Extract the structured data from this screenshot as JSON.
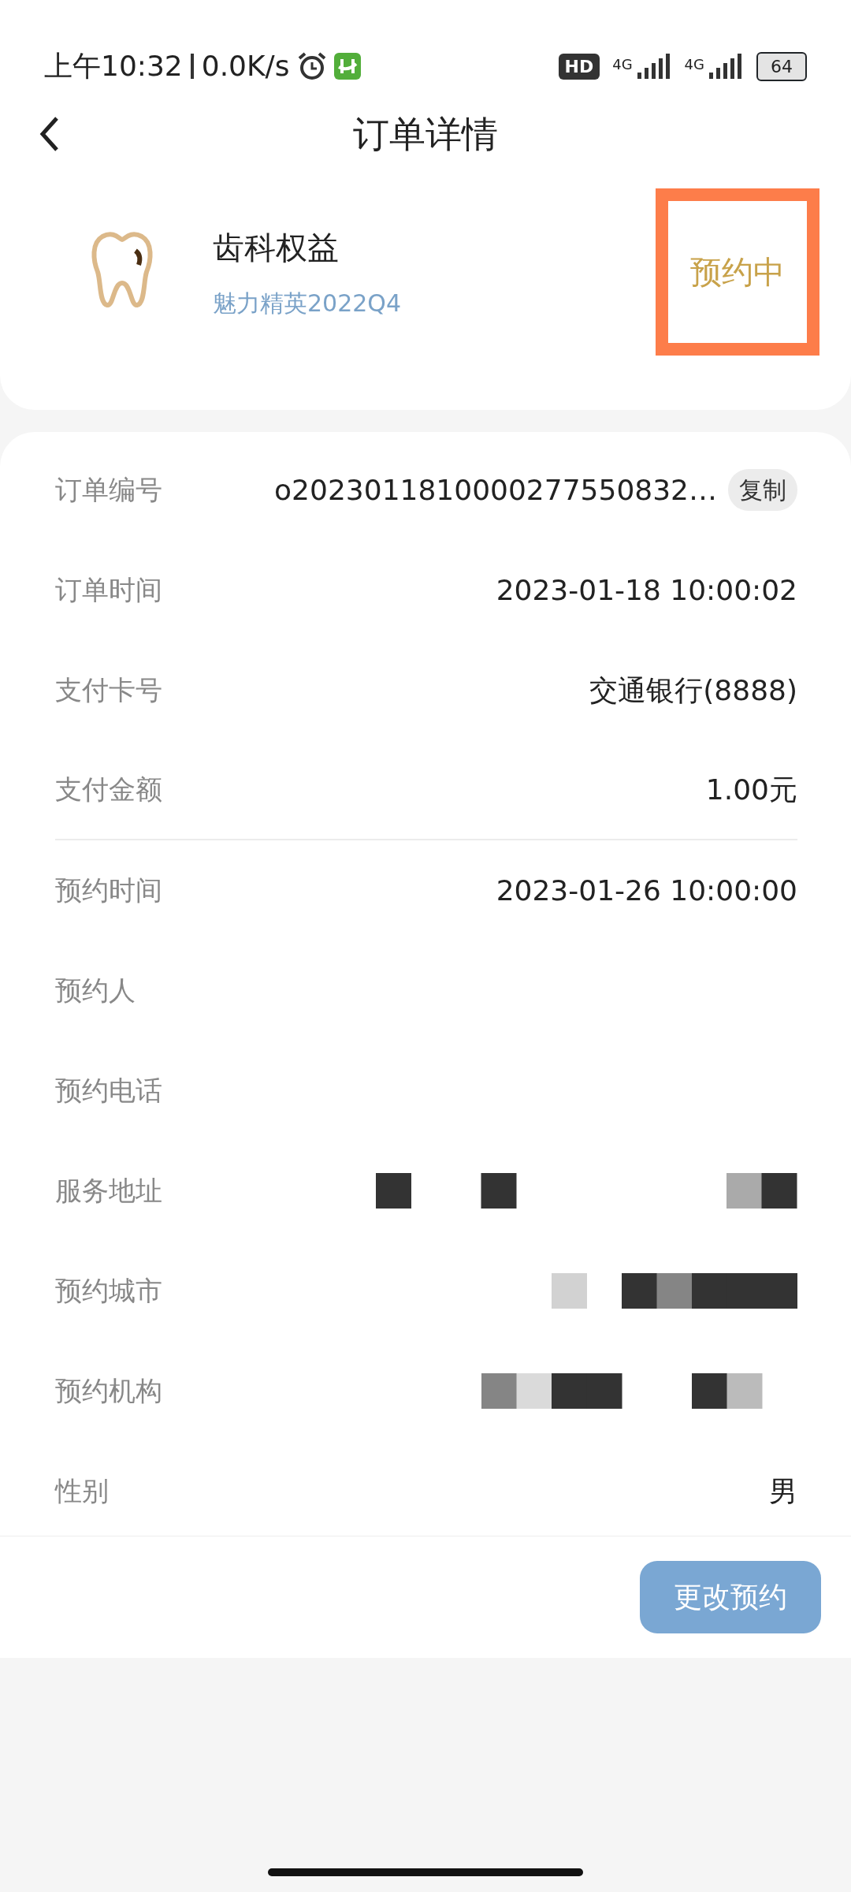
{
  "status_bar": {
    "time": "上午10:32",
    "speed": "0.0K/s",
    "hd": "HD",
    "networks": [
      "4G",
      "4G"
    ],
    "battery": "64"
  },
  "header": {
    "title": "订单详情"
  },
  "product": {
    "name": "齿科权益",
    "subtitle": "魅力精英2022Q4",
    "status": "预约中",
    "highlighted": true
  },
  "details": [
    {
      "label": "订单编号",
      "value": "o2023011810000277550832…",
      "action": "复制",
      "divider_after": false,
      "redacted": false
    },
    {
      "label": "订单时间",
      "value": "2023-01-18 10:00:02",
      "divider_after": false,
      "redacted": false
    },
    {
      "label": "支付卡号",
      "value": "交通银行(8888)",
      "divider_after": false,
      "redacted": false
    },
    {
      "label": "支付金额",
      "value": "1.00元",
      "divider_after": true,
      "redacted": false
    },
    {
      "label": "预约时间",
      "value": "2023-01-26 10:00:00",
      "divider_after": false,
      "redacted": false
    },
    {
      "label": "预约人",
      "divider_after": false,
      "redacted": false
    },
    {
      "label": "预约电话",
      "divider_after": false,
      "redacted": false
    },
    {
      "label": "服务地址",
      "divider_after": false,
      "redacted": true
    },
    {
      "label": "预约城市",
      "divider_after": false,
      "redacted": true
    },
    {
      "label": "预约机构",
      "divider_after": false,
      "redacted": true
    },
    {
      "label": "性别",
      "value": "男",
      "divider_after": false,
      "redacted": false
    }
  ],
  "footer": {
    "button": "更改预约"
  }
}
